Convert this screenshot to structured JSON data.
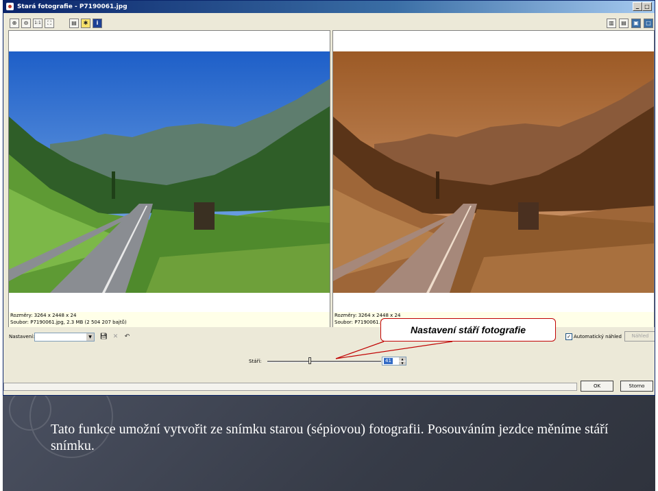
{
  "window": {
    "title": "Stará fotografie - P7190061.jpg",
    "controls": {
      "minimize": "_",
      "maximize": "□",
      "close": "×"
    }
  },
  "toolbar": {
    "left_tools": [
      "zoom-in-icon",
      "zoom-out-icon",
      "actual-size-icon",
      "fit-icon",
      "histogram-icon",
      "highlight-icon",
      "info-icon"
    ],
    "right_tools": [
      "side-by-side-view-icon",
      "split-view-icon",
      "single-view-icon",
      "fullscreen-icon"
    ]
  },
  "panels": {
    "original": {
      "info_line1": "Rozměry: 3264 x 2448 x 24",
      "info_line2": "Soubor: P7190061.jpg, 2.3 MB (2 504 207 bajtů)"
    },
    "preview": {
      "info_line1": "Rozměry: 3264 x 2448 x 24",
      "info_line2": "Soubor: P7190061.jpg, 2.3 MB (2 504 207 bajtů)"
    }
  },
  "settings": {
    "label": "Nastavení:",
    "preset_value": "",
    "auto_preview_label": "Automatický náhled",
    "auto_preview_checked": true,
    "preview_button": "Náhled"
  },
  "age": {
    "label": "Stáří:",
    "value": "41",
    "slider_fraction": 0.36
  },
  "buttons": {
    "ok": "OK",
    "cancel": "Storno"
  },
  "callout": {
    "text": "Nastavení stáří fotografie"
  },
  "caption": {
    "text": "Tato funkce umožní vytvořit ze snímku starou (sépiovou) fotografii. Posouváním jezdce měníme stáří snímku."
  },
  "colors": {
    "accent": "#0A246A",
    "callout_border": "#C00000",
    "sepia": "#A0643A"
  }
}
